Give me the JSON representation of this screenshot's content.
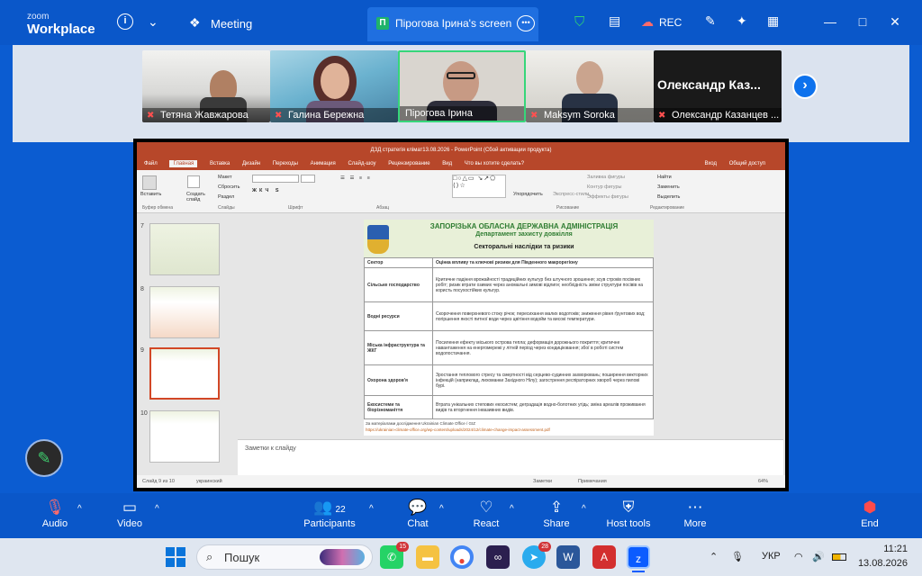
{
  "topbar": {
    "brand_line1": "zoom",
    "brand_line2": "Workplace",
    "meeting_label": "Meeting",
    "share_tab_label": "Пірогова Ірина's screen",
    "share_tab_icon_letter": "П",
    "rec_label": "REC"
  },
  "gallery": {
    "participants": [
      {
        "name": "Тетяна Жавжарова",
        "muted": true
      },
      {
        "name": "Галина Бережна",
        "muted": true
      },
      {
        "name": "Пірогова Ірина",
        "muted": false
      },
      {
        "name": "Maksym Soroka",
        "muted": true
      },
      {
        "name": "Олександр Казанцев ...",
        "muted": true,
        "display_name": "Олександр  Каз..."
      }
    ]
  },
  "ppt": {
    "window_title": "ДЗД стратегія клімат13.08.2026 - PowerPoint (Сбой активации продукта)",
    "menu": [
      "Файл",
      "Главная",
      "Вставка",
      "Дизайн",
      "Переходы",
      "Анимация",
      "Слайд-шоу",
      "Рецензирование",
      "Вид",
      "Что вы хотите сделать?"
    ],
    "menu_right": [
      "Вход",
      "Общий доступ"
    ],
    "ribbon": {
      "paste": "Вставить",
      "create_slide": "Создать слайд",
      "layout": "Макет",
      "reset": "Сбросить",
      "section": "Раздел",
      "groups": [
        "Буфер обмена",
        "Слайды",
        "Шрифт",
        "Абзац",
        "Рисование",
        "Редактирование"
      ],
      "arrange": "Упорядочить",
      "quick_styles": "Экспресс-стили",
      "fill": "Заливка фигуры",
      "outline": "Контур фигуры",
      "effects": "Эффекты фигуры",
      "find": "Найти",
      "replace": "Заменить",
      "select": "Выделить"
    },
    "thumb_numbers": [
      "7",
      "8",
      "9",
      "10"
    ],
    "slide": {
      "org": "ЗАПОРІЗЬКА ОБЛАСНА ДЕРЖАВНА АДМІНІСТРАЦІЯ",
      "dept": "Департамент захисту довкілля",
      "title": "Секторальні наслідки та ризики",
      "col1": "Сектор",
      "col2": "Оцінка впливу та ключові ризики для Південного макрорегіону",
      "rows": [
        {
          "sector": "Сільське господарство",
          "text": "Критичне падіння врожайності традиційних культур без штучного зрошення; зсув строків посівних робіт; ризик втрати озимих через аномальні зимові відлиги; необхідність зміни структури посівів на користь посухостійких культур."
        },
        {
          "sector": "Водні ресурси",
          "text": "Скорочення поверхневого стоку річок; пересихання малих водотоків; зниження рівня ґрунтових вод; погіршення якості питної води через цвітіння водойм та високі температури."
        },
        {
          "sector": "Міська інфраструктура та ЖКГ",
          "text": "Посилення ефекту міського острова тепла; деформація дорожнього покриття; критичне навантаження на енергомережі у літній період через кондиціювання; збої в роботі систем водопостачання."
        },
        {
          "sector": "Охорона здоров'я",
          "text": "Зростання теплового стресу та смертності від серцево-судинних захворювань; поширення векторних інфекцій (наприклад, лихоманки Західного Нілу); загострення респіраторних хвороб через пилові бурі."
        },
        {
          "sector": "Екосистеми та біорізноманіття",
          "text": "Втрата унікальних степових екосистем; деградація водно-болотних угідь; зміна ареалів проживання видів та вторгнення інвазивних видів."
        }
      ],
      "source": "За матеріалами дослідження Ukrainian Climate Office / GIZ",
      "link": "https://ukrainian-climate-office.org/wp-content/uploads/2024/12/climate-change-impact-assessment.pdf"
    },
    "notes_placeholder": "Заметки к слайду",
    "status_left": "Слайд 9 из 10",
    "status_lang": "украинский",
    "status_notes": "Заметки",
    "status_comments": "Примечания",
    "zoom": "64%"
  },
  "controls": {
    "audio": "Audio",
    "video": "Video",
    "participants": "Participants",
    "participants_count": "22",
    "chat": "Chat",
    "react": "React",
    "share": "Share",
    "host_tools": "Host tools",
    "more": "More",
    "end": "End"
  },
  "taskbar": {
    "search_placeholder": "Пошук",
    "whatsapp_badge": "15",
    "telegram_badge": "28",
    "lang": "УКР",
    "time": "11:21",
    "date": "13.08.2026"
  },
  "colors": {
    "zoom_blue": "#0a57c9",
    "ppt_red": "#b7472a",
    "green_accent": "#1fb36b",
    "end_red": "#e02828"
  }
}
